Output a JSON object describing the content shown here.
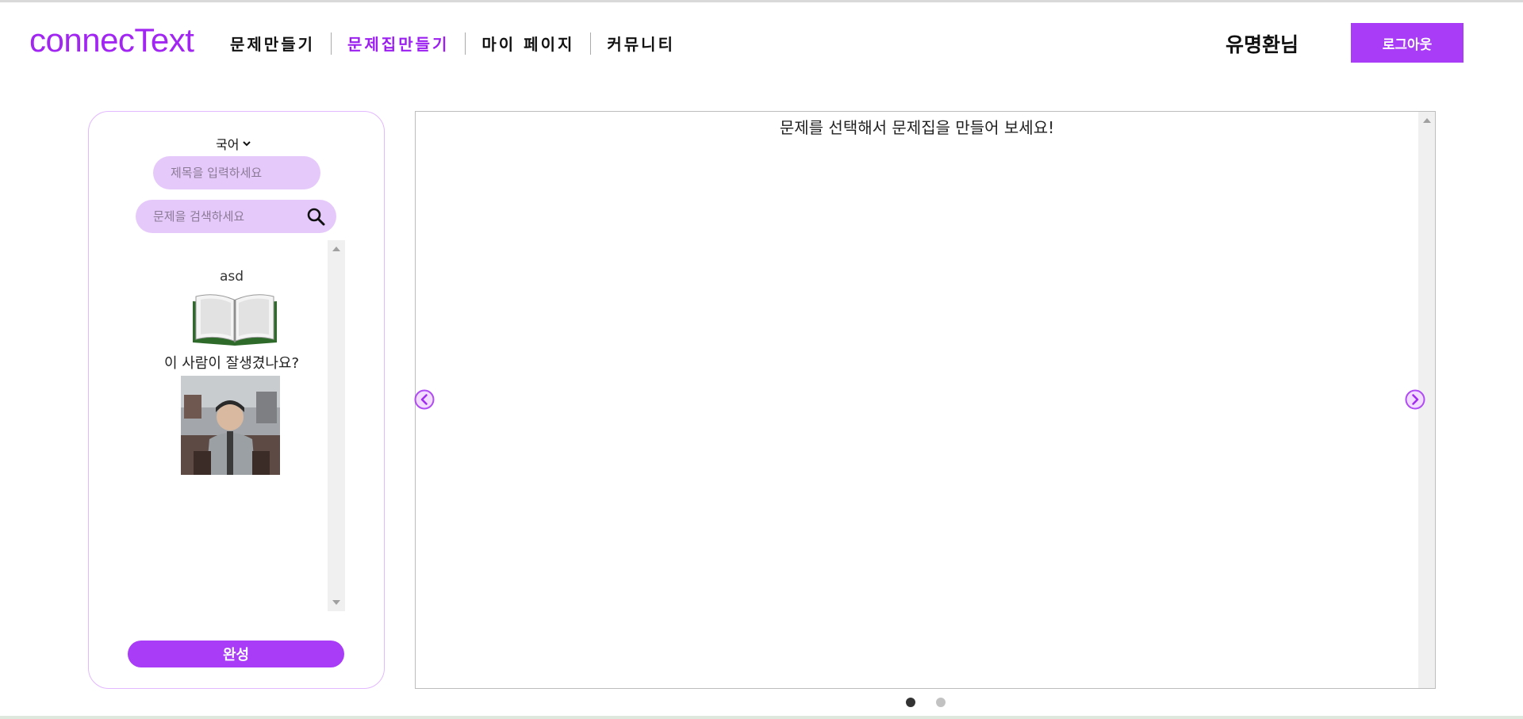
{
  "header": {
    "logo": "connecText",
    "nav": [
      {
        "label": "문제만들기"
      },
      {
        "label": "문제집만들기"
      },
      {
        "label": "마이 페이지"
      },
      {
        "label": "커뮤니티"
      }
    ],
    "username": "유명환님",
    "logout_label": "로그아웃"
  },
  "left_panel": {
    "subject": "국어",
    "title_placeholder": "제목을 입력하세요",
    "search_placeholder": "문제을 검색하세요",
    "items": [
      {
        "title": "asd",
        "question": "이 사람이 잘생겼나요?"
      }
    ],
    "done_label": "완성"
  },
  "main": {
    "message": "문제를 선택해서 문제집을 만들어 보세요!",
    "pagination": {
      "total": 2,
      "current": 1
    }
  },
  "colors": {
    "accent": "#a83cf7",
    "logo": "#a226f2",
    "input_bg": "#e6c9fb"
  }
}
